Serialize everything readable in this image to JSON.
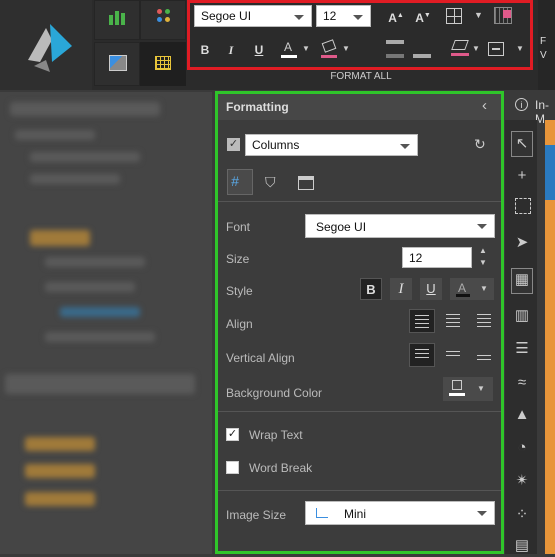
{
  "ribbon": {
    "font_family": "Segoe UI",
    "font_size": "12",
    "bold": "B",
    "italic": "I",
    "underline": "U",
    "increase_font": "A",
    "decrease_font": "A",
    "section_label": "FORMAT ALL"
  },
  "top_right": {
    "label": "In-M",
    "partial1": "F",
    "partial2": "V"
  },
  "panel": {
    "title": "Formatting",
    "element_select": "Columns",
    "font_label": "Font",
    "font_value": "Segoe UI",
    "size_label": "Size",
    "size_value": "12",
    "style_label": "Style",
    "bold": "B",
    "italic": "I",
    "underline": "U",
    "align_label": "Align",
    "valign_label": "Vertical Align",
    "bg_label": "Background Color",
    "wrap_label": "Wrap Text",
    "break_label": "Word Break",
    "image_size_label": "Image Size",
    "image_size_value": "Mini"
  },
  "colors": {
    "highlight_red": "#e01c24",
    "highlight_green": "#2fc52a",
    "accent_orange": "#e8953a"
  },
  "icons": [
    "logo-icon",
    "bar-chart-icon",
    "dots-icon",
    "image-icon",
    "grid-icon",
    "borders-icon",
    "format-painter-icon",
    "pen-icon",
    "text-box-icon",
    "reset-icon",
    "conditional-format-icon",
    "paint-bucket-icon",
    "column-header-icon",
    "select-icon",
    "crosshair-icon",
    "marquee-icon",
    "cursor-icon",
    "table-icon",
    "bars-icon",
    "hbars-icon",
    "wave-icon",
    "area-icon",
    "pie-icon",
    "radar-icon",
    "scatter-icon"
  ]
}
